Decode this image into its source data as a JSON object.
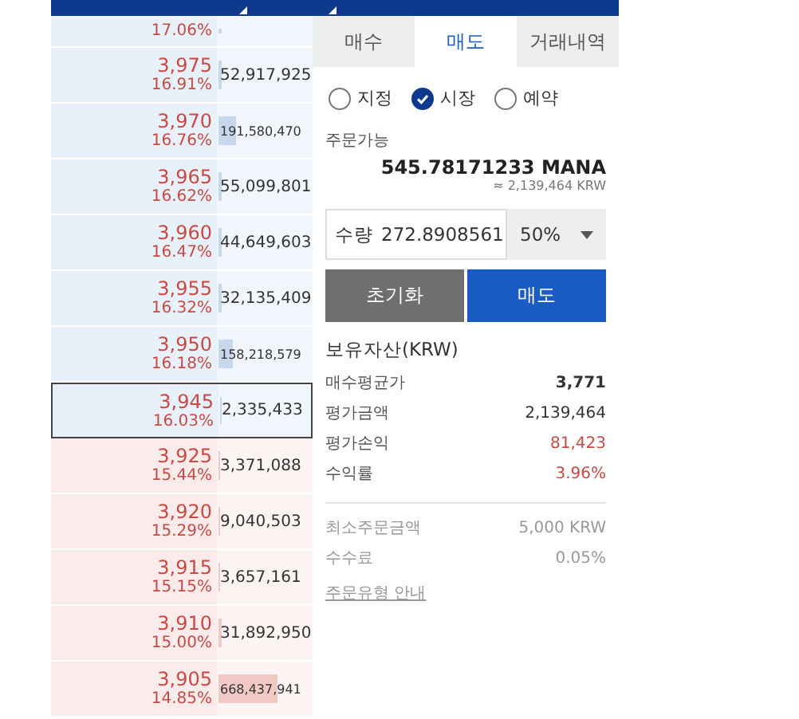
{
  "orderbook": [
    {
      "change": "17.06%",
      "level": 0.03,
      "kind": "ask",
      "selected": false
    },
    {
      "price": "3,975",
      "change": "16.91%",
      "volume": "52,917,925",
      "level": 0.04,
      "kind": "ask",
      "selected": false
    },
    {
      "price": "3,970",
      "change": "16.76%",
      "volume": "191,580,470",
      "level": 0.18,
      "kind": "ask",
      "selected": false
    },
    {
      "price": "3,965",
      "change": "16.62%",
      "volume": "55,099,801",
      "level": 0.04,
      "kind": "ask",
      "selected": false
    },
    {
      "price": "3,960",
      "change": "16.47%",
      "volume": "44,649,603",
      "level": 0.03,
      "kind": "ask",
      "selected": false
    },
    {
      "price": "3,955",
      "change": "16.32%",
      "volume": "32,135,409",
      "level": 0.03,
      "kind": "ask",
      "selected": false
    },
    {
      "price": "3,950",
      "change": "16.18%",
      "volume": "158,218,579",
      "level": 0.15,
      "kind": "ask",
      "selected": false
    },
    {
      "price": "3,945",
      "change": "16.03%",
      "volume": "2,335,433",
      "level": 0.01,
      "kind": "ask",
      "selected": true
    },
    {
      "price": "3,925",
      "change": "15.44%",
      "volume": "3,371,088",
      "level": 0.01,
      "kind": "bid",
      "selected": false
    },
    {
      "price": "3,920",
      "change": "15.29%",
      "volume": "9,040,503",
      "level": 0.02,
      "kind": "bid",
      "selected": false
    },
    {
      "price": "3,915",
      "change": "15.15%",
      "volume": "3,657,161",
      "level": 0.01,
      "kind": "bid",
      "selected": false
    },
    {
      "price": "3,910",
      "change": "15.00%",
      "volume": "31,892,950",
      "level": 0.03,
      "kind": "bid",
      "selected": false
    },
    {
      "price": "3,905",
      "change": "14.85%",
      "volume": "668,437,941",
      "level": 0.62,
      "kind": "bid",
      "selected": false
    }
  ],
  "tabs": [
    {
      "label": "매수",
      "selected": false
    },
    {
      "label": "매도",
      "selected": true
    },
    {
      "label": "거래내역",
      "selected": false
    }
  ],
  "order_types": [
    {
      "label": "지정",
      "selected": false
    },
    {
      "label": "시장",
      "selected": true
    },
    {
      "label": "예약",
      "selected": false
    }
  ],
  "available": {
    "label": "주문가능",
    "amount": "545.78171233 MANA",
    "krw": "≈ 2,139,464 KRW"
  },
  "quantity": {
    "label": "수량",
    "value": "272.8908561",
    "percent": "50%"
  },
  "buttons": {
    "reset": "초기화",
    "submit": "매도"
  },
  "holdings": {
    "title": "보유자산(KRW)",
    "rows": [
      {
        "label": "매수평균가",
        "value": "3,771",
        "kind": "bold"
      },
      {
        "label": "평가금액",
        "value": "2,139,464",
        "kind": "plain"
      },
      {
        "label": "평가손익",
        "value": "81,423",
        "kind": "up"
      },
      {
        "label": "수익률",
        "value": "3.96%",
        "kind": "up"
      }
    ]
  },
  "info": [
    {
      "label": "최소주문금액",
      "value": "5,000 KRW"
    },
    {
      "label": "수수료",
      "value": "0.05%"
    }
  ],
  "guide_link": "주문유형 안내"
}
